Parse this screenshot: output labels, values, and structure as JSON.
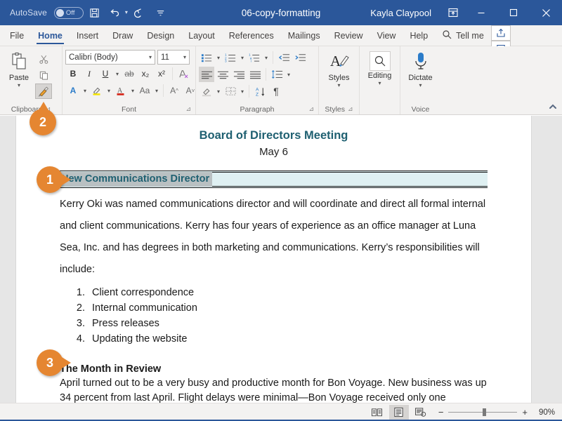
{
  "titlebar": {
    "autosave_label": "AutoSave",
    "autosave_state": "Off",
    "save_icon": "save-icon",
    "undo_icon": "undo-icon",
    "redo_icon": "redo-icon",
    "customize_qat_icon": "customize-quick-access-toolbar-icon",
    "document_title": "06-copy-formatting",
    "user_name": "Kayla Claypool",
    "ribbon_display_icon": "ribbon-display-options-icon",
    "minimize_label": "—",
    "maximize_label": "▢",
    "close_label": "✕",
    "accent_color": "#2b579a"
  },
  "tabs": [
    {
      "label": "File",
      "active": false
    },
    {
      "label": "Home",
      "active": true
    },
    {
      "label": "Insert",
      "active": false
    },
    {
      "label": "Draw",
      "active": false
    },
    {
      "label": "Design",
      "active": false
    },
    {
      "label": "Layout",
      "active": false
    },
    {
      "label": "References",
      "active": false
    },
    {
      "label": "Mailings",
      "active": false
    },
    {
      "label": "Review",
      "active": false
    },
    {
      "label": "View",
      "active": false
    },
    {
      "label": "Help",
      "active": false
    }
  ],
  "tellme": {
    "label": "Tell me",
    "icon": "search-icon"
  },
  "tabbar_right": {
    "share_icon": "share-icon",
    "comments_icon": "comments-icon"
  },
  "ribbon": {
    "clipboard": {
      "group_label": "Clipboard",
      "paste_label": "Paste",
      "paste_caret": "▾",
      "cut_icon": "cut-scissors-icon",
      "copy_icon": "copy-icon",
      "format_painter_icon": "format-painter-icon",
      "dialog_launcher": "⊿"
    },
    "font": {
      "group_label": "Font",
      "font_name": "Calibri (Body)",
      "font_size": "11",
      "bold": "B",
      "italic": "I",
      "underline": "U",
      "underline_caret": "▾",
      "strikethrough": "ab",
      "subscript": "x₂",
      "superscript": "x²",
      "clear_formatting_icon": "clear-formatting-icon",
      "text_effects_icon": "text-effects-icon",
      "highlight_icon": "text-highlight-color-icon",
      "font_color_icon": "font-color-icon",
      "change_case": "Aa",
      "grow_font": "A",
      "shrink_font": "A",
      "dialog_launcher": "⊿"
    },
    "paragraph": {
      "group_label": "Paragraph",
      "bullets_icon": "bullet-list-icon",
      "numbering_icon": "numbered-list-icon",
      "multilevel_icon": "multilevel-list-icon",
      "decrease_indent_icon": "decrease-indent-icon",
      "increase_indent_icon": "increase-indent-icon",
      "align_left_icon": "align-left-icon",
      "align_center_icon": "align-center-icon",
      "align_right_icon": "align-right-icon",
      "justify_icon": "justify-icon",
      "line_spacing_icon": "line-spacing-icon",
      "shading_icon": "shading-icon",
      "borders_icon": "borders-icon",
      "sort_icon": "sort-icon",
      "show_marks_icon": "show-formatting-marks-icon",
      "dialog_launcher": "⊿"
    },
    "styles": {
      "group_label": "Styles",
      "button_label": "Styles",
      "caret": "▾",
      "icon": "styles-icon",
      "dialog_launcher": "⊿"
    },
    "editing": {
      "button_label": "Editing",
      "caret": "▾",
      "icon": "editing-find-icon"
    },
    "voice": {
      "group_label": "Voice",
      "button_label": "Dictate",
      "caret": "▾",
      "icon": "microphone-icon"
    },
    "collapse_icon": "collapse-ribbon-icon"
  },
  "document": {
    "title": "Board of Directors Meeting",
    "subtitle": "May 6",
    "heading1": "New Communications Director",
    "paragraph1": "Kerry Oki was named communications director and will coordinate and direct all formal internal and client communications. Kerry has four years of experience as an office manager at Luna Sea, Inc. and has degrees in both marketing and communications. Kerry’s responsibilities will include:",
    "list": [
      "Client correspondence",
      "Internal communication",
      "Press releases",
      "Updating the website"
    ],
    "heading2": "The Month in Review",
    "paragraph2": "April turned out to be a very busy and productive month for Bon Voyage. New business was up 34 percent from last April. Flight delays were minimal—Bon Voyage received only one customer complaint because of a delay.",
    "heading_color": "#1f6071",
    "heading_highlight_color": "#b9c0c2",
    "heading_band_color": "#dff0f2"
  },
  "callouts": [
    {
      "number": "1",
      "direction": "right"
    },
    {
      "number": "2",
      "direction": "up"
    },
    {
      "number": "3",
      "direction": "right"
    }
  ],
  "statusbar": {
    "read_mode_icon": "read-mode-icon",
    "print_layout_icon": "print-layout-icon",
    "web_layout_icon": "web-layout-icon",
    "zoom_out": "−",
    "zoom_in": "+",
    "zoom_level": "90%"
  }
}
